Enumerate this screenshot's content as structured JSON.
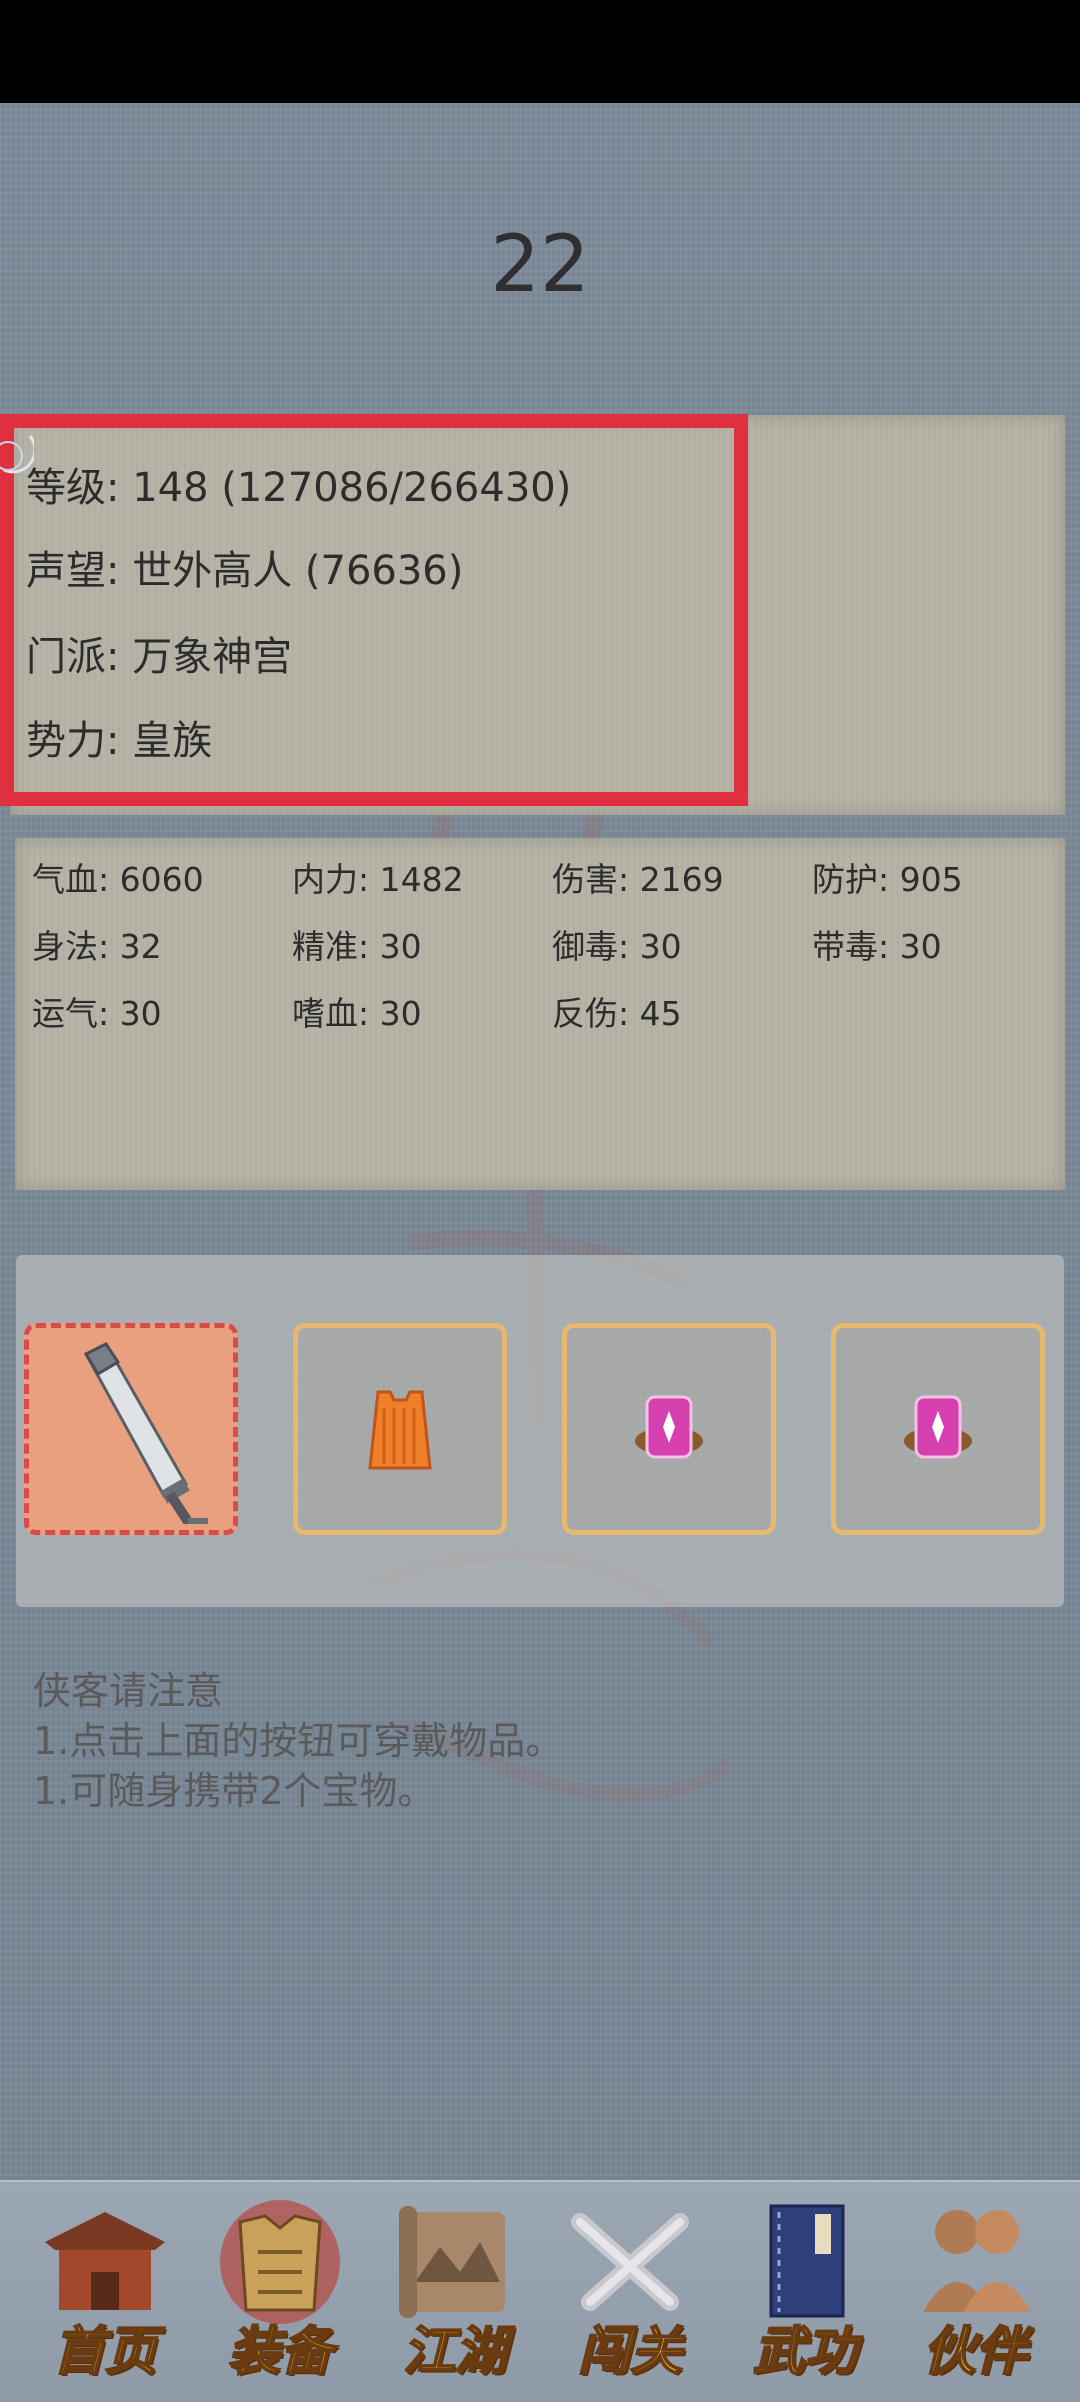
{
  "header": {
    "number": "22"
  },
  "profile": {
    "level": "等级: 148 (127086/266430)",
    "reputation": "声望: 世外高人 (76636)",
    "sect": "门派: 万象神宫",
    "faction": "势力:  皇族"
  },
  "stats": [
    "气血: 6060",
    "内力: 1482",
    "伤害: 2169",
    "防护: 905",
    "身法: 32",
    "精准: 30",
    "御毒: 30",
    "带毒: 30",
    "运气: 30",
    "嗜血: 30",
    "反伤: 45"
  ],
  "equipment": [
    {
      "item": "sword-icon",
      "selected": true
    },
    {
      "item": "armor-icon",
      "selected": false
    },
    {
      "item": "treasure-icon",
      "selected": false
    },
    {
      "item": "treasure-icon",
      "selected": false
    }
  ],
  "notice": {
    "title": "侠客请注意",
    "line1": "1.点击上面的按钮可穿戴物品。",
    "line2": "1.可随身携带2个宝物。"
  },
  "nav": [
    {
      "label": "首页",
      "icon": "house-icon"
    },
    {
      "label": "装备",
      "icon": "armor-icon"
    },
    {
      "label": "江湖",
      "icon": "scroll-icon"
    },
    {
      "label": "闯关",
      "icon": "crossed-swords-icon"
    },
    {
      "label": "武功",
      "icon": "book-icon"
    },
    {
      "label": "伙伴",
      "icon": "companions-icon"
    }
  ],
  "colors": {
    "highlight": "#e0303f",
    "nav_text": "#f2c02f",
    "slot_border": "#e8b86f"
  }
}
